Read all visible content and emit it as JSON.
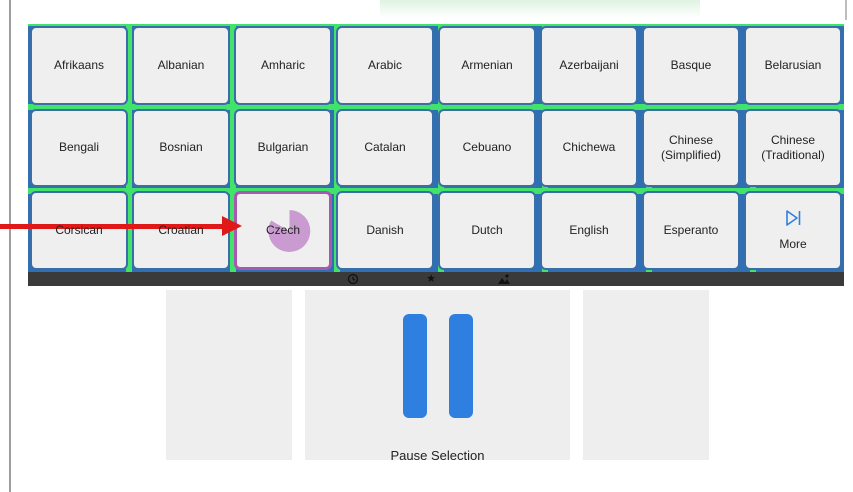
{
  "grid": {
    "rows": [
      [
        "Afrikaans",
        "Albanian",
        "Amharic",
        "Arabic",
        "Armenian",
        "Azerbaijani",
        "Basque",
        "Belarusian"
      ],
      [
        "Bengali",
        "Bosnian",
        "Bulgarian",
        "Catalan",
        "Cebuano",
        "Chichewa",
        "Chinese\n(Simplified)",
        "Chinese\n(Traditional)"
      ],
      [
        "Corsican",
        "Croatian",
        "Czech",
        "Danish",
        "Dutch",
        "English",
        "Esperanto"
      ]
    ],
    "selected": "Czech",
    "more_label": "More"
  },
  "colors": {
    "grid_line": "#41e36a",
    "cell_border": "#3b6da6",
    "selection_border": "#a55ab0",
    "dwell_progress": "#c99bd0",
    "pause_bars": "#2f7fe0",
    "annotation_arrow": "#e01818"
  },
  "toolbar": {
    "icons": [
      "history-icon",
      "star-icon",
      "scene-icon"
    ]
  },
  "pause": {
    "label": "Pause Selection"
  }
}
